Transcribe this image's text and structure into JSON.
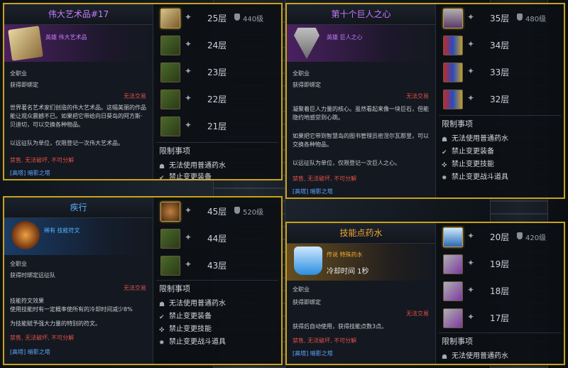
{
  "panels": [
    {
      "title": "伟大艺术品#17",
      "grade": "英雄 伟大艺术品",
      "job": "全职业",
      "bind": "获得即绑定",
      "no_trade": "无法交易",
      "desc": [
        "世界著名艺术家们创造的伟大艺术品。这幅美丽的作品",
        "能让观众震撼不已。如果把它带给向日葵岛的阿方斯·",
        "贝迪切，可以交换各种物品。",
        "",
        "以远征队为单位，仅限登记一次伟大艺术品。"
      ],
      "flags": "禁售, 无法破坏, 不可分解",
      "source": "[高塔] 暗影之塔",
      "floors": [
        {
          "label": "25层",
          "level": "440级"
        },
        {
          "label": "24层"
        },
        {
          "label": "23层"
        },
        {
          "label": "22层"
        },
        {
          "label": "21层"
        }
      ],
      "restrict_title": "限制事项",
      "restrictions": [
        "无法使用普通药水",
        "禁止变更装备"
      ]
    },
    {
      "title": "第十个巨人之心",
      "grade": "英雄 巨人之心",
      "job": "全职业",
      "bind": "获得即绑定",
      "no_trade": "无法交易",
      "desc": [
        "凝聚着巨人力量的核心。虽然看起来像一块巨石，但能",
        "隐约地感觉到心跳。",
        "",
        "如果把它带到智慧岛的图书管理员密涅尔瓦那里，可以",
        "交换各种物品。",
        "",
        "以远征队为单位，仅限登记一次巨人之心。"
      ],
      "flags": "禁售, 无法破坏, 不可分解",
      "source": "[高塔] 暗影之塔",
      "floors": [
        {
          "label": "35层",
          "level": "480级"
        },
        {
          "label": "34层"
        },
        {
          "label": "33层"
        },
        {
          "label": "32层"
        }
      ],
      "restrict_title": "限制事项",
      "restrictions": [
        "无法使用普通药水",
        "禁止变更装备",
        "禁止变更技能",
        "禁止变更战斗道具"
      ]
    },
    {
      "title": "疾行",
      "grade": "稀有 技能符文",
      "job": "全职业",
      "bind": "获得时绑定远征队",
      "no_trade": "无法交易",
      "effect_title": "技能符文效果",
      "effect": "使用技能时有一定概率使所有的冷却时间减少8%",
      "effect2": "为技能赋予强大力量的特别的符文。",
      "flags": "禁售, 无法破坏, 不可分解",
      "source": "[高塔] 暗影之塔",
      "floors": [
        {
          "label": "45层",
          "level": "520级"
        },
        {
          "label": "44层"
        },
        {
          "label": "43层"
        }
      ],
      "restrict_title": "限制事项",
      "restrictions": [
        "无法使用普通药水",
        "禁止变更装备",
        "禁止变更技能",
        "禁止变更战斗道具"
      ]
    },
    {
      "title": "技能点药水",
      "grade": "传说 特殊药水",
      "cooldown": "冷却时间 1秒",
      "job": "全职业",
      "bind": "获得即绑定",
      "no_trade": "无法交易",
      "desc": [
        "获得后自动使用，获得技能点数3点。"
      ],
      "flags": "禁售, 无法破坏, 不可分解",
      "source": "[高塔] 暗影之塔",
      "floors": [
        {
          "label": "20层",
          "level": "420级"
        },
        {
          "label": "19层"
        },
        {
          "label": "18层"
        },
        {
          "label": "17层"
        }
      ],
      "restrict_title": "限制事项",
      "restrictions": [
        "无法使用普通药水"
      ]
    }
  ],
  "colors": {
    "border": "#c9a21a",
    "purple_title": "#c77dff",
    "gold_title": "#f2a733",
    "blue_title": "#56b2ff",
    "red": "#e0504a"
  }
}
